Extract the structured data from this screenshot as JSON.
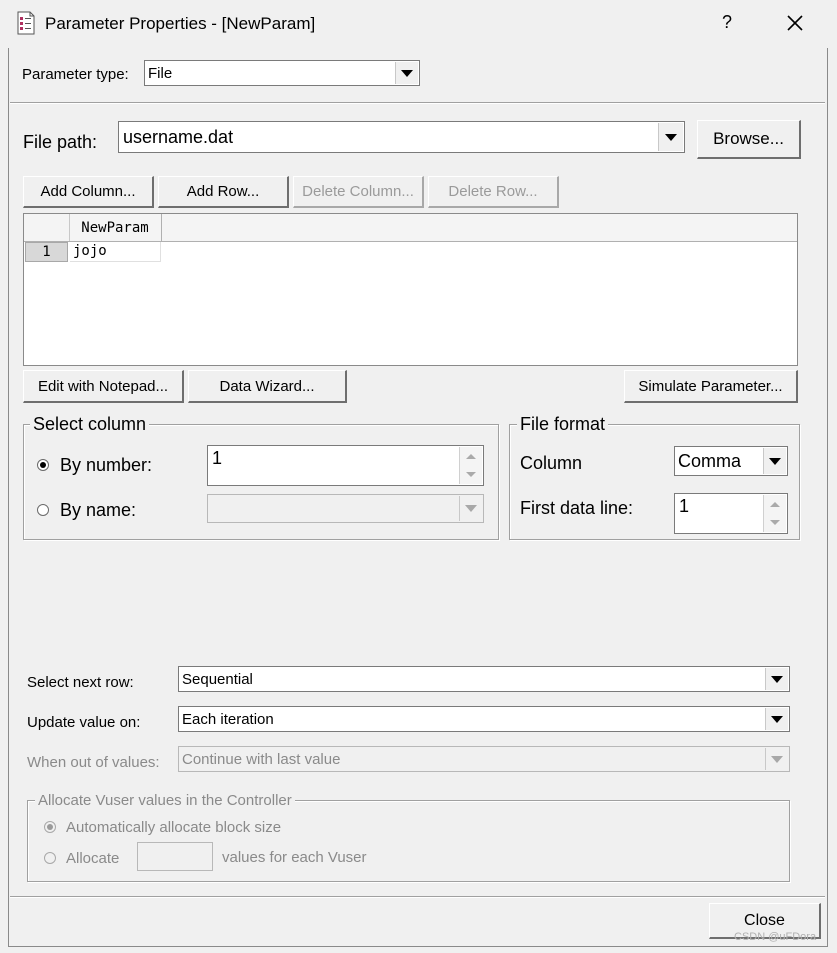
{
  "window": {
    "title": "Parameter Properties - [NewParam]",
    "help_label": "?",
    "close_icon": "close-icon"
  },
  "param_type": {
    "label": "Parameter type:",
    "value": "File"
  },
  "file_path": {
    "label": "File path:",
    "value": "username.dat",
    "browse_label": "Browse..."
  },
  "grid_toolbar": {
    "add_column": "Add Column...",
    "add_row": "Add Row...",
    "delete_column": "Delete Column...",
    "delete_row": "Delete Row..."
  },
  "grid": {
    "columns": [
      "NewParam"
    ],
    "rows": [
      {
        "index": "1",
        "cells": [
          "jojo"
        ]
      }
    ]
  },
  "grid_actions": {
    "edit_notepad": "Edit with Notepad...",
    "data_wizard": "Data Wizard...",
    "simulate": "Simulate Parameter..."
  },
  "select_column": {
    "title": "Select column",
    "by_number_label": "By number:",
    "by_number_value": "1",
    "by_name_label": "By name:",
    "selected": "by_number"
  },
  "file_format": {
    "title": "File format",
    "column_label": "Column",
    "column_value": "Comma",
    "first_line_label": "First data line:",
    "first_line_value": "1"
  },
  "row_options": {
    "next_row_label": "Select next row:",
    "next_row_value": "Sequential",
    "update_label": "Update value on:",
    "update_value": "Each iteration",
    "out_of_values_label": "When out of values:",
    "out_of_values_value": "Continue with last value"
  },
  "allocate": {
    "title": "Allocate Vuser values in the Controller",
    "auto_label": "Automatically allocate block size",
    "manual_label": "Allocate",
    "manual_suffix": "values for each Vuser"
  },
  "footer": {
    "close_label": "Close",
    "watermark": "CSDN @uFDora"
  }
}
